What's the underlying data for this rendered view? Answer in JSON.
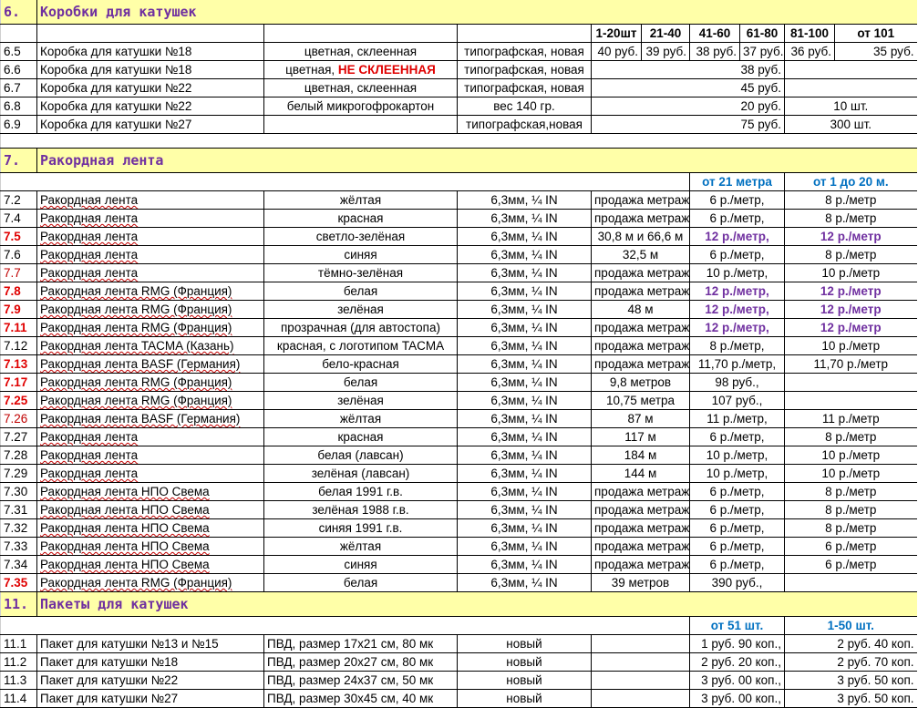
{
  "sections": {
    "s6": {
      "num": "6.",
      "title": "Коробки  для  катушек"
    },
    "s7": {
      "num": "7.",
      "title": "Ракордная  лента"
    },
    "s11": {
      "num": "11.",
      "title": "Пакеты  для  катушек"
    }
  },
  "boxes_header": [
    "1-20шт",
    "21-40",
    "41-60",
    "61-80",
    "81-100",
    "от 101"
  ],
  "boxes": [
    {
      "id": "6.5",
      "name": "Коробка для катушки №18",
      "desc": "цветная, склеенная",
      "type": "типографская, новая",
      "p": [
        "40 руб.",
        "39 руб.",
        "38 руб.",
        "37 руб.",
        "36 руб.",
        "35 руб."
      ]
    },
    {
      "id": "6.6",
      "name": "Коробка для катушки №18",
      "desc_a": "цветная, ",
      "desc_b": "НЕ СКЛЕЕННАЯ",
      "type": "типографская, новая",
      "price": "38 руб."
    },
    {
      "id": "6.7",
      "name": "Коробка для катушки №22",
      "desc": "цветная, склеенная",
      "type": "типографская, новая",
      "price": "45 руб."
    },
    {
      "id": "6.8",
      "name": "Коробка для катушки №22",
      "desc": "белый микрогофрокартон",
      "type": "вес 140 гр.",
      "price": "20 руб.",
      "extra": "10 шт."
    },
    {
      "id": "6.9",
      "name": "Коробка для катушки №27",
      "desc": "",
      "type": "типографская,новая",
      "price": "75 руб.",
      "extra": "300 шт."
    }
  ],
  "tape_header": [
    "от 21 метра",
    "от 1 до 20 м."
  ],
  "tape": [
    {
      "id": "7.2",
      "name": "Ракордная лента",
      "color": "жёлтая",
      "size": "6,3мм, ¼ IN",
      "sale": "продажа метражом",
      "p1": "6 р./метр,",
      "p2": "8 р./метр",
      "style": ""
    },
    {
      "id": "7.4",
      "name": "Ракордная лента",
      "color": "красная",
      "size": "6,3мм, ¼ IN",
      "sale": "продажа метражом",
      "p1": "6 р./метр,",
      "p2": "8 р./метр",
      "style": ""
    },
    {
      "id": "7.5",
      "name": "Ракордная лента",
      "color": "светло-зелёная",
      "size": "6,3мм, ¼ IN",
      "sale": "30,8 м и 66,6 м",
      "p1": "12 р./метр,",
      "p2": "12 р./метр",
      "style": "hot"
    },
    {
      "id": "7.6",
      "name": "Ракордная лента",
      "color": "синяя",
      "size": "6,3мм, ¼ IN",
      "sale": "32,5 м",
      "p1": "6 р./метр,",
      "p2": "8 р./метр",
      "style": ""
    },
    {
      "id": "7.7",
      "name": "Ракордная лента",
      "color": "тёмно-зелёная",
      "size": "6,3мм, ¼ IN",
      "sale": "продажа метражом",
      "p1": "10 р./метр,",
      "p2": "10 р./метр",
      "style": "redid"
    },
    {
      "id": "7.8",
      "name": "Ракордная лента RMG (Франция)",
      "color": "белая",
      "size": "6,3мм, ¼ IN",
      "sale": "продажа метражом",
      "p1": "12 р./метр,",
      "p2": "12 р./метр",
      "style": "hot"
    },
    {
      "id": "7.9",
      "name": "Ракордная лента RMG (Франция)",
      "color": "зелёная",
      "size": "6,3мм, ¼ IN",
      "sale": "48 м",
      "p1": "12 р./метр,",
      "p2": "12 р./метр",
      "style": "hot"
    },
    {
      "id": "7.11",
      "name": "Ракордная лента RMG (Франция)",
      "color": "прозрачная (для автостопа)",
      "size": "6,3мм, ¼ IN",
      "sale": "продажа метражом",
      "p1": "12 р./метр,",
      "p2": "12 р./метр",
      "style": "hot"
    },
    {
      "id": "7.12",
      "name": "Ракордная лента TACMA (Казань)",
      "color": "красная, с логотипом TACMA",
      "size": "6,3мм, ¼ IN",
      "sale": "продажа метражом",
      "p1": "8 р./метр,",
      "p2": "10 р./метр",
      "style": ""
    },
    {
      "id": "7.13",
      "name": "Ракордная лента BASF (Германия)",
      "color": "бело-красная",
      "size": "6,3мм, ¼ IN",
      "sale": "продажа метражом",
      "p1": "11,70 р./метр,",
      "p2": "11,70 р./метр",
      "style": "boldid"
    },
    {
      "id": "7.17",
      "name": "Ракордная лента RMG (Франция)",
      "color": "белая",
      "size": "6,3мм, ¼ IN",
      "sale": "9,8 метров",
      "p1": "98 руб.,",
      "p2": "",
      "style": "boldid"
    },
    {
      "id": "7.25",
      "name": "Ракордная лента RMG (Франция)",
      "color": "зелёная",
      "size": "6,3мм, ¼ IN",
      "sale": "10,75 метра",
      "p1": "107 руб.,",
      "p2": "",
      "style": "boldid"
    },
    {
      "id": "7.26",
      "name": "Ракордная лента BASF (Германия)",
      "color": "жёлтая",
      "size": "6,3мм, ¼ IN",
      "sale": "87 м",
      "p1": "11 р./метр,",
      "p2": "11 р./метр",
      "style": "redid"
    },
    {
      "id": "7.27",
      "name": "Ракордная лента",
      "color": "красная",
      "size": "6,3мм, ¼ IN",
      "sale": "117 м",
      "p1": "6 р./метр,",
      "p2": "8 р./метр",
      "style": ""
    },
    {
      "id": "7.28",
      "name": "Ракордная лента",
      "color": "белая (лавсан)",
      "size": "6,3мм, ¼ IN",
      "sale": "184 м",
      "p1": "10 р./метр,",
      "p2": "10 р./метр",
      "style": ""
    },
    {
      "id": "7.29",
      "name": "Ракордная лента",
      "color": "зелёная (лавсан)",
      "size": "6,3мм, ¼ IN",
      "sale": "144 м",
      "p1": "10 р./метр,",
      "p2": "10 р./метр",
      "style": ""
    },
    {
      "id": "7.30",
      "name": "Ракордная лента НПО Свема",
      "color": "белая 1991 г.в.",
      "size": "6,3мм, ¼ IN",
      "sale": "продажа метражом",
      "p1": "6 р./метр,",
      "p2": "8 р./метр",
      "style": ""
    },
    {
      "id": "7.31",
      "name": "Ракордная лента НПО Свема",
      "color": "зелёная 1988 г.в.",
      "size": "6,3мм, ¼ IN",
      "sale": "продажа метражом",
      "p1": "6 р./метр,",
      "p2": "8 р./метр",
      "style": ""
    },
    {
      "id": "7.32",
      "name": "Ракордная лента НПО Свема",
      "color": "синяя 1991 г.в.",
      "size": "6,3мм, ¼ IN",
      "sale": "продажа метражом",
      "p1": "6 р./метр,",
      "p2": "8 р./метр",
      "style": ""
    },
    {
      "id": "7.33",
      "name": "Ракордная лента НПО Свема",
      "color": "жёлтая",
      "size": "6,3мм, ¼ IN",
      "sale": "продажа метражом",
      "p1": "6 р./метр,",
      "p2": "6 р./метр",
      "style": ""
    },
    {
      "id": "7.34",
      "name": "Ракордная лента НПО Свема",
      "color": "синяя",
      "size": "6,3мм, ¼ IN",
      "sale": "продажа метражом",
      "p1": "6 р./метр,",
      "p2": "6 р./метр",
      "style": ""
    },
    {
      "id": "7.35",
      "name": "Ракордная лента RMG (Франция)",
      "color": "белая",
      "size": "6,3мм, ¼ IN",
      "sale": "39 метров",
      "p1": "390 руб.,",
      "p2": "",
      "style": "boldid"
    }
  ],
  "bags_header": [
    "от 51 шт.",
    "1-50 шт."
  ],
  "bags": [
    {
      "id": "11.1",
      "name": "Пакет для катушки №13 и №15",
      "spec": "ПВД, размер 17х21 см, 80 мк",
      "cond": "новый",
      "p1": "1 руб. 90 коп.,",
      "p2": "2 руб. 40 коп."
    },
    {
      "id": "11.2",
      "name": "Пакет для катушки №18",
      "spec": "ПВД, размер 20х27 см, 80 мк",
      "cond": "новый",
      "p1": "2 руб. 20 коп.,",
      "p2": "2 руб. 70 коп."
    },
    {
      "id": "11.3",
      "name": "Пакет для катушки №22",
      "spec": "ПВД, размер 24х37 см, 50 мк",
      "cond": "новый",
      "p1": "3 руб. 00 коп.,",
      "p2": "3 руб. 50 коп."
    },
    {
      "id": "11.4",
      "name": "Пакет для катушки №27",
      "spec": "ПВД, размер 30х45 см, 40 мк",
      "cond": "новый",
      "p1": "3 руб. 00 коп.,",
      "p2": "3 руб. 50 коп."
    }
  ]
}
